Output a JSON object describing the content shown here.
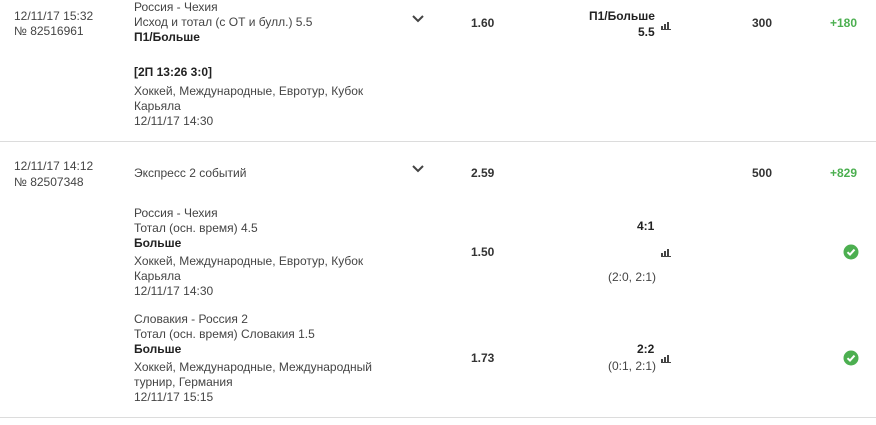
{
  "bet1": {
    "date": "12/11/17 15:32",
    "number": "№ 82516961",
    "event": "Россия - Чехия",
    "market": "Исход и тотал (с ОТ и булл.) 5.5",
    "pick": "П1/Больше",
    "live_info": "[2П 13:26 3:0]",
    "league_line1": "Хоккей, Международные, Евротур, Кубок",
    "league_line2": "Карьяла",
    "event_date": "12/11/17 14:30",
    "odds": "1.60",
    "result_line1": "П1/Больше",
    "result_line2": "5.5",
    "stake": "300",
    "profit": "+180"
  },
  "bet2": {
    "date": "12/11/17 14:12",
    "number": "№ 82507348",
    "title": "Экспресс 2 событий",
    "odds": "2.59",
    "stake": "500",
    "profit": "+829",
    "events": [
      {
        "event": "Россия - Чехия",
        "market": "Тотал (осн. время) 4.5",
        "pick": "Больше",
        "league_line1": "Хоккей, Международные, Евротур, Кубок",
        "league_line2": "Карьяла",
        "event_date": "12/11/17 14:30",
        "odds": "1.50",
        "score": "4:1",
        "periods": "(2:0, 2:1)"
      },
      {
        "event": "Словакия - Россия 2",
        "market": "Тотал (осн. время) Словакия 1.5",
        "pick": "Больше",
        "league_line1": "Хоккей, Международные, Международный",
        "league_line2": "турнир, Германия",
        "event_date": "12/11/17 15:15",
        "odds": "1.73",
        "score": "2:2",
        "periods": "(0:1, 2:1)"
      }
    ]
  },
  "icons": {
    "chevron": "chevron-down-icon",
    "stats": "bar-chart-icon",
    "won": "check-circle-icon"
  },
  "colors": {
    "profit": "#4caf50",
    "separator": "#dcdcdc"
  }
}
